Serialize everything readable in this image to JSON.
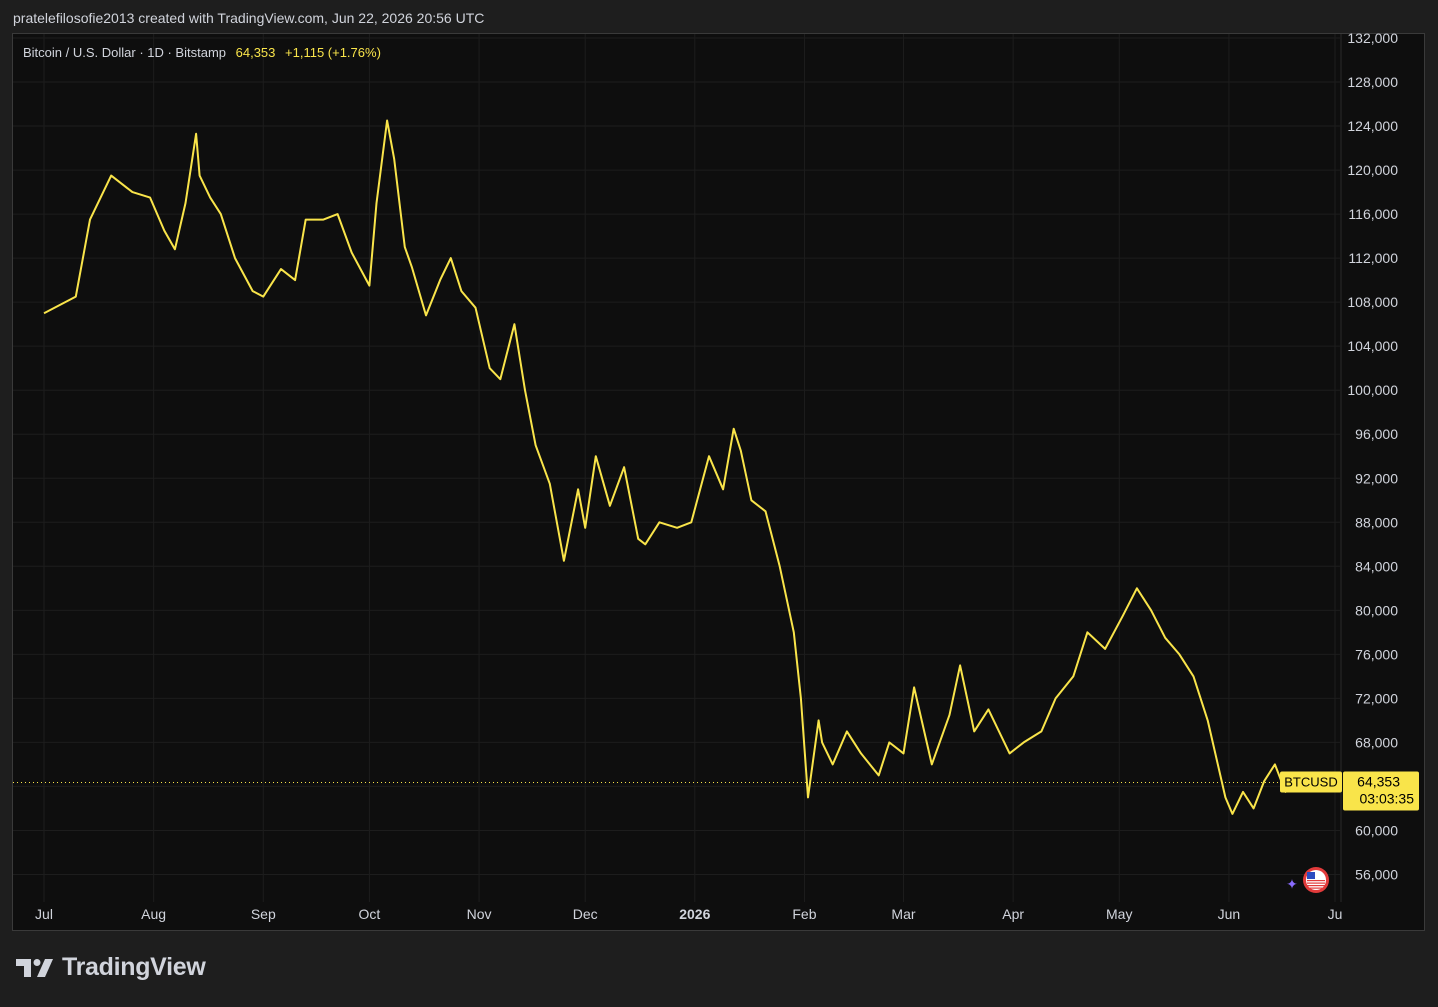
{
  "header": {
    "caption": "pratelefilosofie2013 created with TradingView.com, Jun 22, 2026 20:56 UTC"
  },
  "legend": {
    "symbol_text": "Bitcoin / U.S. Dollar · 1D · Bitstamp",
    "price": "64,353",
    "change": "+1,115 (+1.76%)"
  },
  "price_tag": {
    "ticker": "BTCUSD",
    "price": "64,353",
    "countdown": "03:03:35"
  },
  "footer": {
    "brand": "TradingView"
  },
  "colors": {
    "line": "#f9e44a",
    "background": "#0e0e0e",
    "grid": "#1d1d1d",
    "axis_text": "#d1d4dc"
  },
  "chart_data": {
    "type": "line",
    "x_unit": "date",
    "x_start": "2025-07-01",
    "x": [
      "2025-07-01",
      "2025-07-10",
      "2025-07-14",
      "2025-07-20",
      "2025-07-26",
      "2025-07-31",
      "2025-08-04",
      "2025-08-07",
      "2025-08-10",
      "2025-08-13",
      "2025-08-14",
      "2025-08-17",
      "2025-08-20",
      "2025-08-24",
      "2025-08-29",
      "2025-09-01",
      "2025-09-06",
      "2025-09-10",
      "2025-09-13",
      "2025-09-18",
      "2025-09-22",
      "2025-09-26",
      "2025-10-01",
      "2025-10-03",
      "2025-10-06",
      "2025-10-08",
      "2025-10-11",
      "2025-10-13",
      "2025-10-17",
      "2025-10-21",
      "2025-10-24",
      "2025-10-27",
      "2025-10-31",
      "2025-11-04",
      "2025-11-07",
      "2025-11-11",
      "2025-11-14",
      "2025-11-17",
      "2025-11-21",
      "2025-11-25",
      "2025-11-29",
      "2025-12-01",
      "2025-12-04",
      "2025-12-08",
      "2025-12-12",
      "2025-12-16",
      "2025-12-18",
      "2025-12-22",
      "2025-12-27",
      "2025-12-31",
      "2026-01-05",
      "2026-01-09",
      "2026-01-12",
      "2026-01-14",
      "2026-01-17",
      "2026-01-21",
      "2026-01-25",
      "2026-01-29",
      "2026-01-31",
      "2026-02-02",
      "2026-02-05",
      "2026-02-06",
      "2026-02-09",
      "2026-02-13",
      "2026-02-17",
      "2026-02-22",
      "2026-02-25",
      "2026-03-01",
      "2026-03-04",
      "2026-03-09",
      "2026-03-14",
      "2026-03-17",
      "2026-03-21",
      "2026-03-25",
      "2026-03-31",
      "2026-04-04",
      "2026-04-09",
      "2026-04-13",
      "2026-04-18",
      "2026-04-22",
      "2026-04-27",
      "2026-05-02",
      "2026-05-06",
      "2026-05-10",
      "2026-05-14",
      "2026-05-18",
      "2026-05-22",
      "2026-05-26",
      "2026-05-31",
      "2026-06-02",
      "2026-06-05",
      "2026-06-08",
      "2026-06-11",
      "2026-06-14",
      "2026-06-17",
      "2026-06-22"
    ],
    "y": [
      107000,
      108500,
      115500,
      119500,
      118000,
      117500,
      114500,
      112800,
      117000,
      123300,
      119500,
      117500,
      116000,
      112000,
      109000,
      108500,
      111000,
      110000,
      115500,
      115500,
      116000,
      112500,
      109500,
      117000,
      124500,
      121000,
      113000,
      111200,
      106800,
      110000,
      112000,
      109000,
      107500,
      102000,
      101000,
      106000,
      100000,
      95000,
      91500,
      84500,
      91000,
      87500,
      94000,
      89500,
      93000,
      86500,
      86000,
      88000,
      87500,
      88000,
      94000,
      91000,
      96500,
      94500,
      90000,
      89000,
      84000,
      78000,
      72000,
      63000,
      70000,
      68000,
      66000,
      69000,
      67000,
      65000,
      68000,
      67000,
      73000,
      66000,
      70500,
      75000,
      69000,
      71000,
      67000,
      68000,
      69000,
      72000,
      74000,
      78000,
      76500,
      79500,
      82000,
      80000,
      77500,
      76000,
      74000,
      70000,
      63000,
      61500,
      63500,
      62000,
      64500,
      66000,
      63500,
      64353
    ],
    "ylim": [
      53500,
      132000
    ],
    "y_ticks": [
      "56,000",
      "60,000",
      "64,000",
      "68,000",
      "72,000",
      "76,000",
      "80,000",
      "84,000",
      "88,000",
      "92,000",
      "96,000",
      "100,000",
      "104,000",
      "108,000",
      "112,000",
      "116,000",
      "120,000",
      "124,000",
      "128,000",
      "132,000"
    ],
    "x_ticks": [
      {
        "label": "Jul",
        "date": "2025-07-01",
        "bold": false
      },
      {
        "label": "Aug",
        "date": "2025-08-01",
        "bold": false
      },
      {
        "label": "Sep",
        "date": "2025-09-01",
        "bold": false
      },
      {
        "label": "Oct",
        "date": "2025-10-01",
        "bold": false
      },
      {
        "label": "Nov",
        "date": "2025-11-01",
        "bold": false
      },
      {
        "label": "Dec",
        "date": "2025-12-01",
        "bold": false
      },
      {
        "label": "2026",
        "date": "2026-01-01",
        "bold": true
      },
      {
        "label": "Feb",
        "date": "2026-02-01",
        "bold": false
      },
      {
        "label": "Mar",
        "date": "2026-03-01",
        "bold": false
      },
      {
        "label": "Apr",
        "date": "2026-04-01",
        "bold": false
      },
      {
        "label": "May",
        "date": "2026-05-01",
        "bold": false
      },
      {
        "label": "Jun",
        "date": "2026-06-01",
        "bold": false
      },
      {
        "label": "Ju",
        "date": "2026-07-01",
        "bold": false
      }
    ],
    "last_price": 64353,
    "grid": true
  }
}
